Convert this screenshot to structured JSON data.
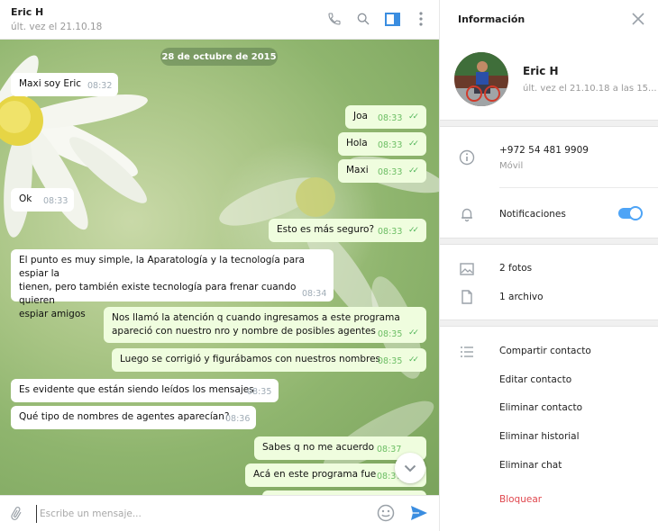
{
  "chat": {
    "title": "Eric H",
    "status": "últ. vez el 21.10.18",
    "date_pill": "28 de octubre de 2015",
    "messages": [
      {
        "text": "Maxi soy Eric",
        "time": "08:32"
      },
      {
        "text": "Joa",
        "time": "08:33"
      },
      {
        "text": "Hola",
        "time": "08:33"
      },
      {
        "text": "Maxi",
        "time": "08:33"
      },
      {
        "text": "Ok",
        "time": "08:33"
      },
      {
        "text": "Esto es más seguro?",
        "time": "08:33"
      },
      {
        "line1": "El punto es muy simple, la Aparatología y la tecnología para espiar la",
        "line2": "tienen, pero también existe tecnología para frenar cuando quieren",
        "line3": "espiar amigos",
        "time": "08:34"
      },
      {
        "line1": "Nos llamó la atención q cuando ingresamos a este programa",
        "line2": "apareció con nuestro nro y nombre de posibles agentes",
        "time": "08:35"
      },
      {
        "text": "Luego se corrigió y figurábamos con nuestros nombres",
        "time": "08:35"
      },
      {
        "text": "Es evidente que están siendo leídos los mensajes",
        "time": "08:35"
      },
      {
        "text": "Qué tipo de nombres de agentes aparecían?",
        "time": "08:36"
      },
      {
        "text": "Sabes q no me acuerdo",
        "time": "08:37"
      },
      {
        "text": "Acá en este programa fue",
        "time": "08:37"
      }
    ],
    "composer_placeholder": "Escribe un mensaje..."
  },
  "info": {
    "title": "Información",
    "name": "Eric H",
    "last_seen": "últ. vez el 21.10.18 a las 15...",
    "phone": "+972 54 481 9909",
    "phone_type": "Móvil",
    "notifications_label": "Notificaciones",
    "notifications_on": true,
    "photos": "2 fotos",
    "files": "1 archivo",
    "actions": {
      "share": "Compartir contacto",
      "edit": "Editar contacto",
      "delete_contact": "Eliminar contacto",
      "delete_history": "Eliminar historial",
      "delete_chat": "Eliminar chat",
      "block": "Bloquear"
    }
  },
  "colors": {
    "accent": "#4ea4f6",
    "outgoing_bubble": "#effdde",
    "check": "#52b55a",
    "danger": "#e0474e"
  },
  "icons": [
    "phone-icon",
    "search-icon",
    "sidebar-toggle-icon",
    "more-icon",
    "chevron-down-icon",
    "attach-icon",
    "emoji-icon",
    "send-icon",
    "close-icon",
    "info-icon",
    "bell-icon",
    "photo-icon",
    "file-icon",
    "list-icon"
  ]
}
